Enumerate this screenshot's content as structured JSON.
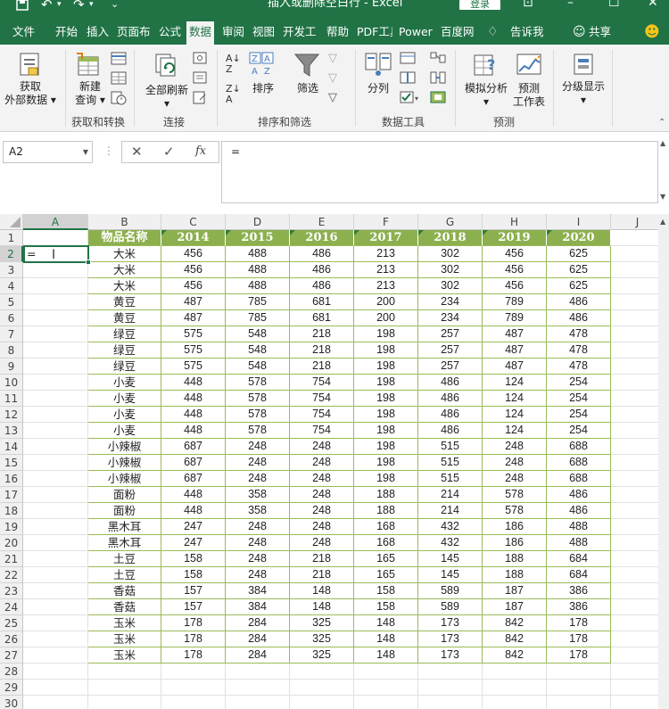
{
  "titlebar": {
    "title": "插入或删除空白行  -  Excel",
    "login": "登录"
  },
  "menu": {
    "tabs": [
      "文件",
      "开始",
      "插入",
      "页面布",
      "公式",
      "数据",
      "审阅",
      "视图",
      "开发工",
      "帮助",
      "PDF工具",
      "Power",
      "百度网",
      "告诉我",
      "共享"
    ],
    "active": "数据"
  },
  "ribbon": {
    "get_external_data": [
      "获取",
      "外部数据"
    ],
    "new_query": [
      "新建",
      "查询"
    ],
    "refresh_all": "全部刷新",
    "sort": "排序",
    "filter": "筛选",
    "text_to_columns": "分列",
    "what_if": "模拟分析",
    "forecast_sheet": [
      "预测",
      "工作表"
    ],
    "outline": "分级显示",
    "groups": {
      "get_transform": "获取和转换",
      "connections": "连接",
      "sort_filter": "排序和筛选",
      "data_tools": "数据工具",
      "forecast": "预测"
    }
  },
  "formulabar": {
    "namebox": "A2",
    "formula": "="
  },
  "sheet": {
    "columns": [
      "A",
      "B",
      "C",
      "D",
      "E",
      "F",
      "G",
      "H",
      "I",
      "J"
    ],
    "active_cell": "A2",
    "active_cell_value": "=",
    "header": [
      "物品名称",
      "2014",
      "2015",
      "2016",
      "2017",
      "2018",
      "2019",
      "2020"
    ],
    "rows": [
      [
        "大米",
        "456",
        "488",
        "486",
        "213",
        "302",
        "456",
        "625"
      ],
      [
        "大米",
        "456",
        "488",
        "486",
        "213",
        "302",
        "456",
        "625"
      ],
      [
        "大米",
        "456",
        "488",
        "486",
        "213",
        "302",
        "456",
        "625"
      ],
      [
        "黄豆",
        "487",
        "785",
        "681",
        "200",
        "234",
        "789",
        "486"
      ],
      [
        "黄豆",
        "487",
        "785",
        "681",
        "200",
        "234",
        "789",
        "486"
      ],
      [
        "绿豆",
        "575",
        "548",
        "218",
        "198",
        "257",
        "487",
        "478"
      ],
      [
        "绿豆",
        "575",
        "548",
        "218",
        "198",
        "257",
        "487",
        "478"
      ],
      [
        "绿豆",
        "575",
        "548",
        "218",
        "198",
        "257",
        "487",
        "478"
      ],
      [
        "小麦",
        "448",
        "578",
        "754",
        "198",
        "486",
        "124",
        "254"
      ],
      [
        "小麦",
        "448",
        "578",
        "754",
        "198",
        "486",
        "124",
        "254"
      ],
      [
        "小麦",
        "448",
        "578",
        "754",
        "198",
        "486",
        "124",
        "254"
      ],
      [
        "小麦",
        "448",
        "578",
        "754",
        "198",
        "486",
        "124",
        "254"
      ],
      [
        "小辣椒",
        "687",
        "248",
        "248",
        "198",
        "515",
        "248",
        "688"
      ],
      [
        "小辣椒",
        "687",
        "248",
        "248",
        "198",
        "515",
        "248",
        "688"
      ],
      [
        "小辣椒",
        "687",
        "248",
        "248",
        "198",
        "515",
        "248",
        "688"
      ],
      [
        "面粉",
        "448",
        "358",
        "248",
        "188",
        "214",
        "578",
        "486"
      ],
      [
        "面粉",
        "448",
        "358",
        "248",
        "188",
        "214",
        "578",
        "486"
      ],
      [
        "黑木耳",
        "247",
        "248",
        "248",
        "168",
        "432",
        "186",
        "488"
      ],
      [
        "黑木耳",
        "247",
        "248",
        "248",
        "168",
        "432",
        "186",
        "488"
      ],
      [
        "土豆",
        "158",
        "248",
        "218",
        "165",
        "145",
        "188",
        "684"
      ],
      [
        "土豆",
        "158",
        "248",
        "218",
        "165",
        "145",
        "188",
        "684"
      ],
      [
        "香菇",
        "157",
        "384",
        "148",
        "158",
        "589",
        "187",
        "386"
      ],
      [
        "香菇",
        "157",
        "384",
        "148",
        "158",
        "589",
        "187",
        "386"
      ],
      [
        "玉米",
        "178",
        "284",
        "325",
        "148",
        "173",
        "842",
        "178"
      ],
      [
        "玉米",
        "178",
        "284",
        "325",
        "148",
        "173",
        "842",
        "178"
      ],
      [
        "玉米",
        "178",
        "284",
        "325",
        "148",
        "173",
        "842",
        "178"
      ]
    ],
    "row_numbers": [
      "1",
      "2",
      "3",
      "4",
      "5",
      "6",
      "7",
      "8",
      "9",
      "10",
      "11",
      "12",
      "13",
      "14",
      "15",
      "16",
      "17",
      "18",
      "19",
      "20",
      "21",
      "22",
      "23",
      "24",
      "25",
      "26",
      "27",
      "28",
      "29",
      "30"
    ]
  }
}
